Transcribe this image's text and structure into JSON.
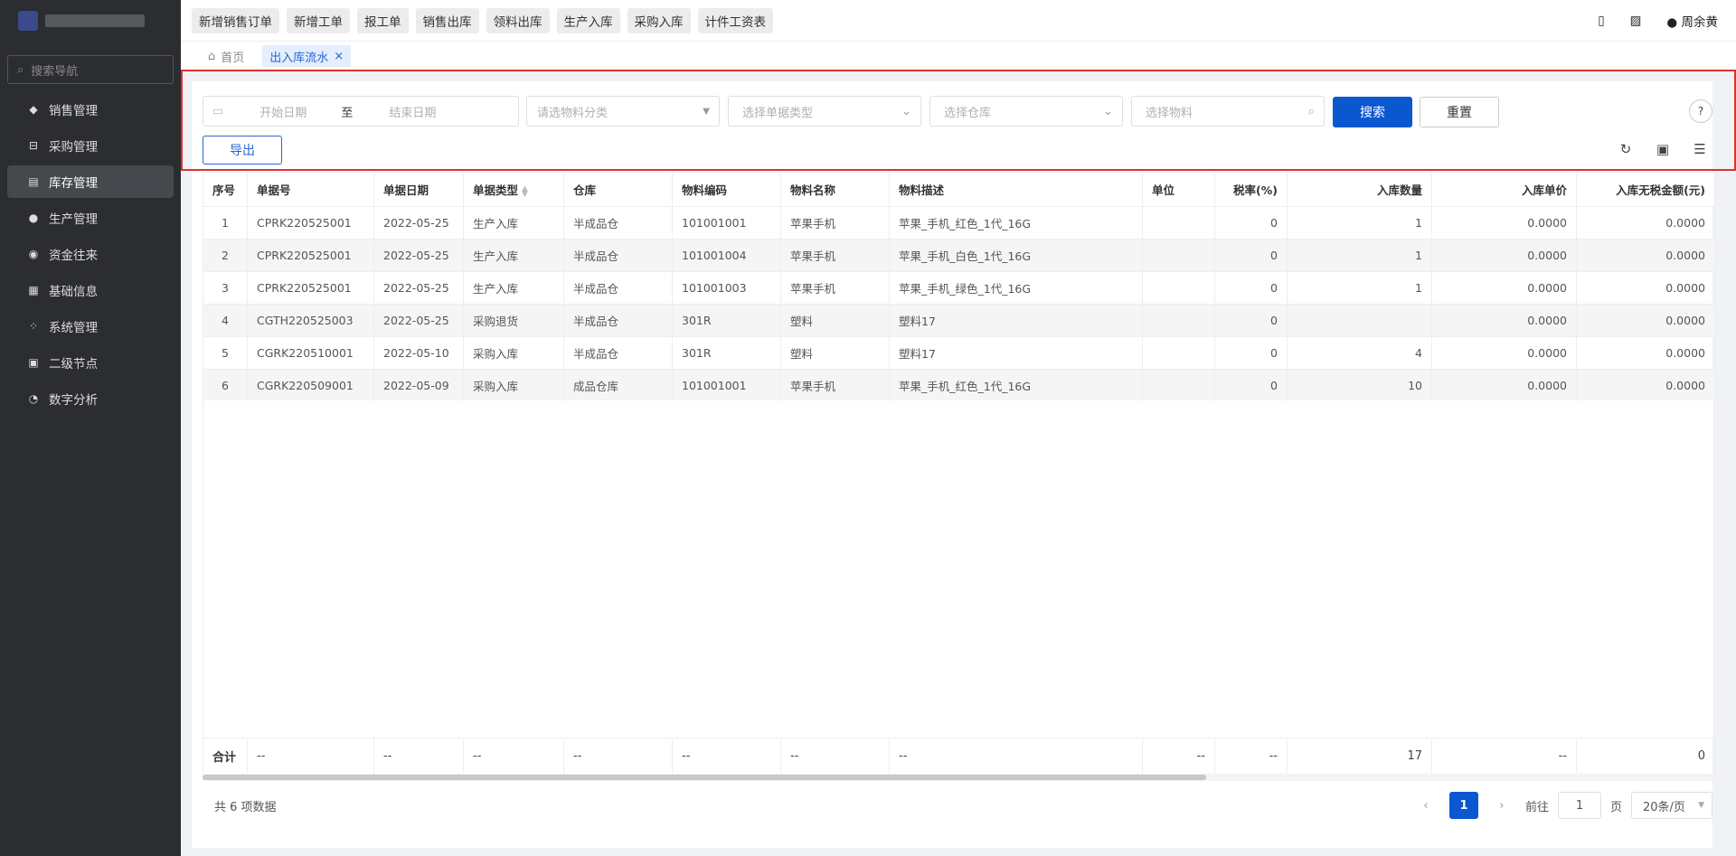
{
  "sidebar": {
    "search_placeholder": "搜索导航",
    "items": [
      {
        "label": "销售管理",
        "icon": "tag-icon"
      },
      {
        "label": "采购管理",
        "icon": "cart-icon"
      },
      {
        "label": "库存管理",
        "icon": "box-icon",
        "active": true
      },
      {
        "label": "生产管理",
        "icon": "factory-icon"
      },
      {
        "label": "资金往来",
        "icon": "coin-icon"
      },
      {
        "label": "基础信息",
        "icon": "grid-icon"
      },
      {
        "label": "系统管理",
        "icon": "apps-icon"
      },
      {
        "label": "二级节点",
        "icon": "doc-icon"
      },
      {
        "label": "数字分析",
        "icon": "pie-icon"
      }
    ]
  },
  "topbar": {
    "quick_buttons": [
      "新增销售订单",
      "新增工单",
      "报工单",
      "销售出库",
      "领料出库",
      "生产入库",
      "采购入库",
      "计件工资表"
    ],
    "user_name": "周余黄"
  },
  "tabs": {
    "home": "首页",
    "current": "出入库流水"
  },
  "filters": {
    "start_date": "开始日期",
    "separator": "至",
    "end_date": "结束日期",
    "material_category": "请选物料分类",
    "doc_type": "选择单据类型",
    "warehouse": "选择仓库",
    "material": "选择物料",
    "search_label": "搜索",
    "reset_label": "重置",
    "export_label": "导出"
  },
  "table": {
    "headers": [
      "序号",
      "单据号",
      "单据日期",
      "单据类型",
      "仓库",
      "物料编码",
      "物料名称",
      "物料描述",
      "单位",
      "税率(%)",
      "入库数量",
      "入库单价",
      "入库无税金额(元)"
    ],
    "rows": [
      [
        "1",
        "CPRK220525001",
        "2022-05-25",
        "生产入库",
        "半成品仓",
        "101001001",
        "苹果手机",
        "苹果_手机_红色_1代_16G",
        "",
        "0",
        "1",
        "0.0000",
        "0.0000"
      ],
      [
        "2",
        "CPRK220525001",
        "2022-05-25",
        "生产入库",
        "半成品仓",
        "101001004",
        "苹果手机",
        "苹果_手机_白色_1代_16G",
        "",
        "0",
        "1",
        "0.0000",
        "0.0000"
      ],
      [
        "3",
        "CPRK220525001",
        "2022-05-25",
        "生产入库",
        "半成品仓",
        "101001003",
        "苹果手机",
        "苹果_手机_绿色_1代_16G",
        "",
        "0",
        "1",
        "0.0000",
        "0.0000"
      ],
      [
        "4",
        "CGTH220525003",
        "2022-05-25",
        "采购退货",
        "半成品仓",
        "301R",
        "塑料",
        "塑料17",
        "",
        "0",
        "",
        "0.0000",
        "0.0000"
      ],
      [
        "5",
        "CGRK220510001",
        "2022-05-10",
        "采购入库",
        "半成品仓",
        "301R",
        "塑料",
        "塑料17",
        "",
        "0",
        "4",
        "0.0000",
        "0.0000"
      ],
      [
        "6",
        "CGRK220509001",
        "2022-05-09",
        "采购入库",
        "成品仓库",
        "101001001",
        "苹果手机",
        "苹果_手机_红色_1代_16G",
        "",
        "0",
        "10",
        "0.0000",
        "0.0000"
      ]
    ],
    "summary": [
      "合计",
      "--",
      "--",
      "--",
      "--",
      "--",
      "--",
      "--",
      "--",
      "--",
      "17",
      "--",
      "0"
    ]
  },
  "footer": {
    "total_text": "共 6 项数据",
    "current_page": "1",
    "goto_label": "前往",
    "goto_value": "1",
    "page_suffix": "页",
    "page_size": "20条/页"
  }
}
